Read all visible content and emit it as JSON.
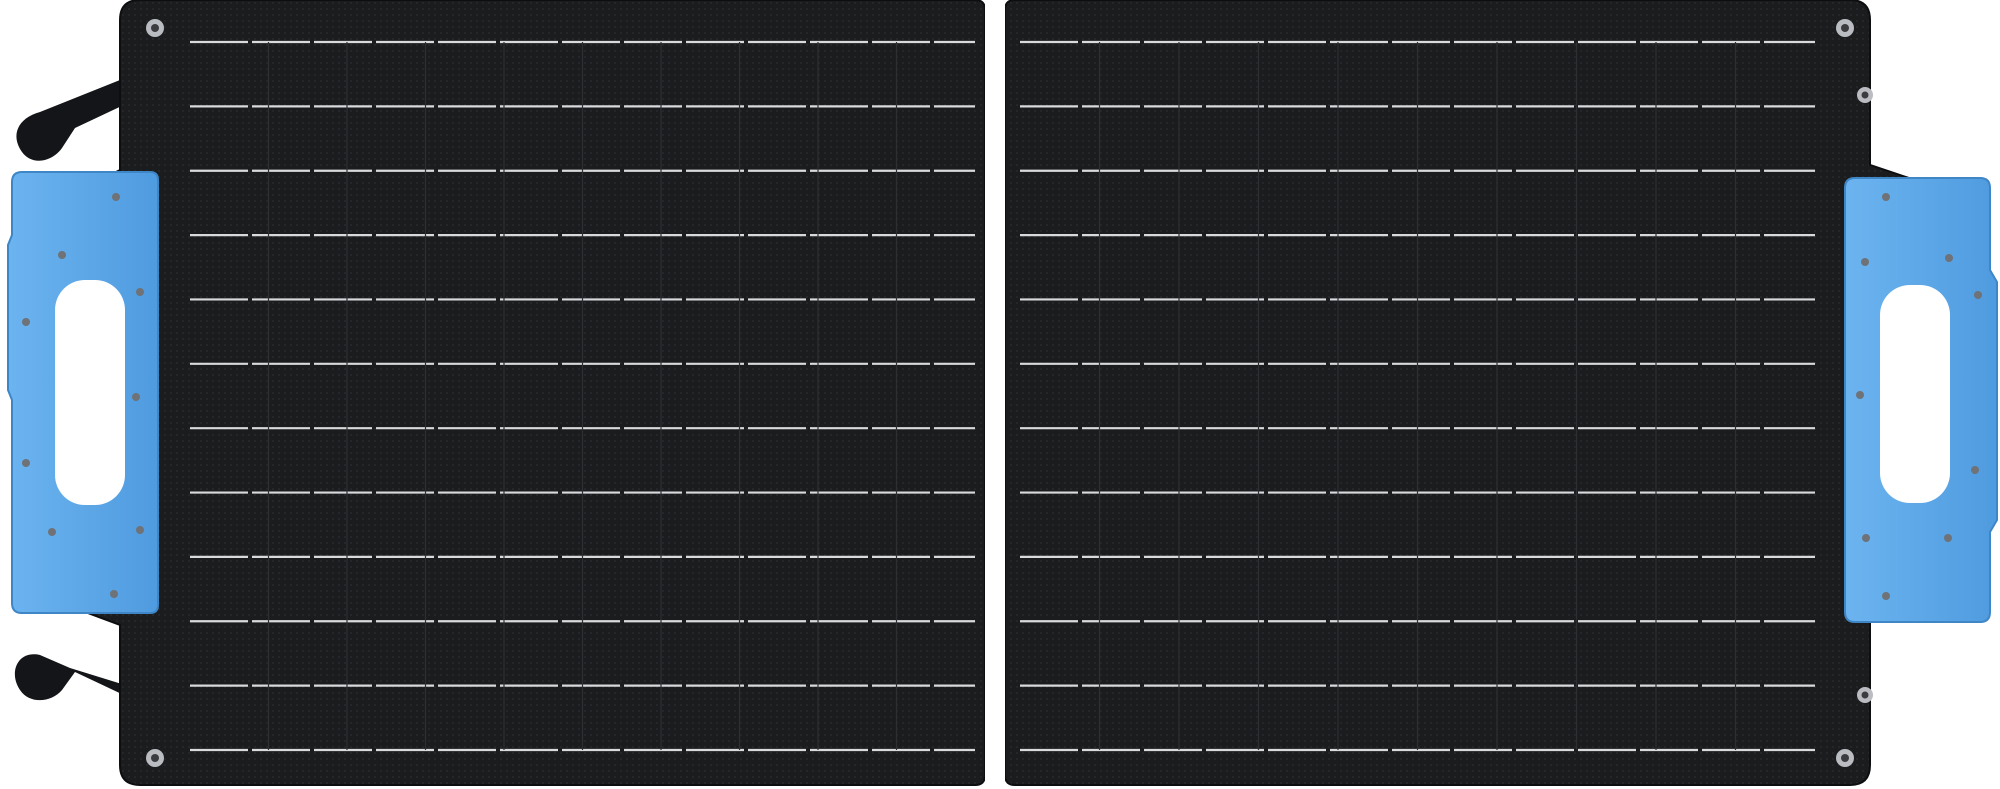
{
  "product": {
    "panel_color": "#1b1c1e",
    "panel_edge_color": "#0d0e10",
    "busbar_color": "#d9dadc",
    "cell_line_color": "#2d2f33",
    "handle_color": "#5aa6e8",
    "handle_shadow_color": "#3f86c6",
    "strap_color": "#141518",
    "grommet_color": "#b9bcc0",
    "screw_color": "#6f7276",
    "icons": [
      "carry-handle-icon",
      "grommet-icon",
      "strap-buckle-icon"
    ]
  }
}
